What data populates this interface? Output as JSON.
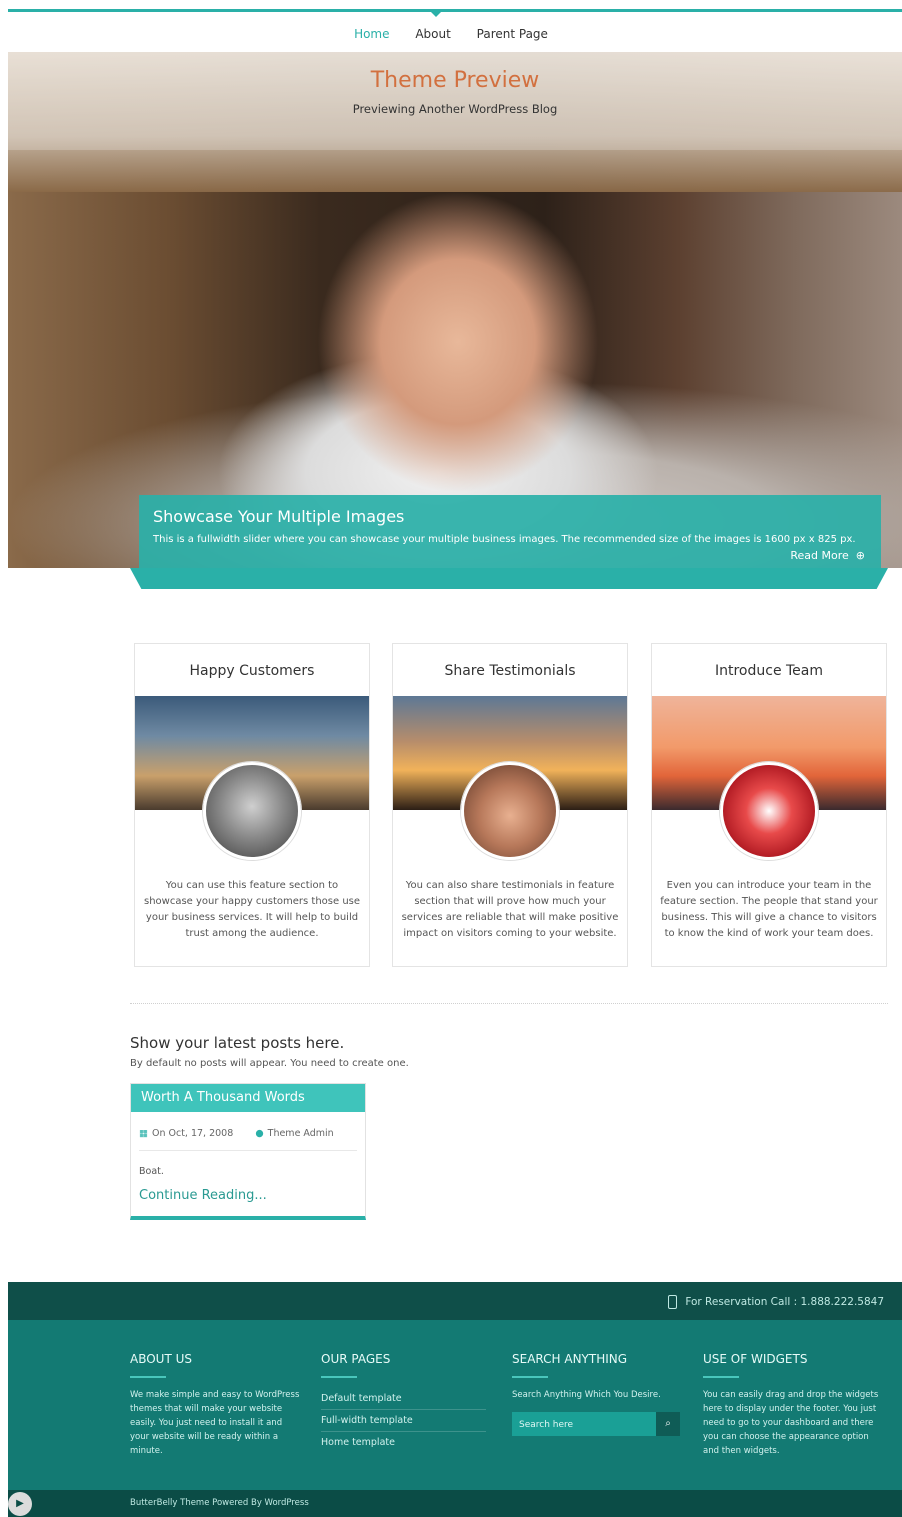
{
  "nav": {
    "items": [
      "Home",
      "About",
      "Parent Page"
    ]
  },
  "site": {
    "title": "Theme Preview",
    "tagline": "Previewing Another WordPress Blog"
  },
  "slider": {
    "caption_title": "Showcase Your Multiple Images",
    "caption_text": "This is a fullwidth slider where you can showcase your multiple business images. The recommended size of the images is 1600 px x 825 px.",
    "read_more": "Read More"
  },
  "features": [
    {
      "title": "Happy Customers",
      "text": "You can use this feature section to showcase your happy customers those use your business services. It will help to build trust among the audience."
    },
    {
      "title": "Share Testimonials",
      "text": "You can also share testimonials in feature section that will prove how much your services are reliable that will make positive impact on visitors coming to your website."
    },
    {
      "title": "Introduce Team",
      "text": "Even you can introduce your team in the feature section. The people that stand your business. This will give a chance to visitors to know the kind of work your team does."
    }
  ],
  "posts": {
    "title": "Show your latest posts here.",
    "subtitle": "By default no posts will appear. You need to create one.",
    "item": {
      "title": "Worth A Thousand Words",
      "date": "On Oct, 17, 2008",
      "author": "Theme Admin",
      "excerpt": "Boat.",
      "continue": "Continue Reading..."
    }
  },
  "footer": {
    "reservation": "For Reservation Call : 1.888.222.5847",
    "about": {
      "title": "ABOUT US",
      "text": "We make simple and easy to WordPress themes that will make your website easily. You just need to install it and your website will be ready within a minute."
    },
    "pages": {
      "title": "OUR PAGES",
      "items": [
        "Default template",
        "Full-width template",
        "Home template"
      ]
    },
    "search": {
      "title": "SEARCH ANYTHING",
      "text": "Search Anything Which You Desire.",
      "placeholder": "Search here"
    },
    "widgets": {
      "title": "USE OF WIDGETS",
      "text": "You can easily drag and drop the widgets here to display under the footer. You just need to go to your dashboard and there you can choose the appearance option and then widgets."
    },
    "powered": "ButterBelly Theme Powered By WordPress"
  }
}
